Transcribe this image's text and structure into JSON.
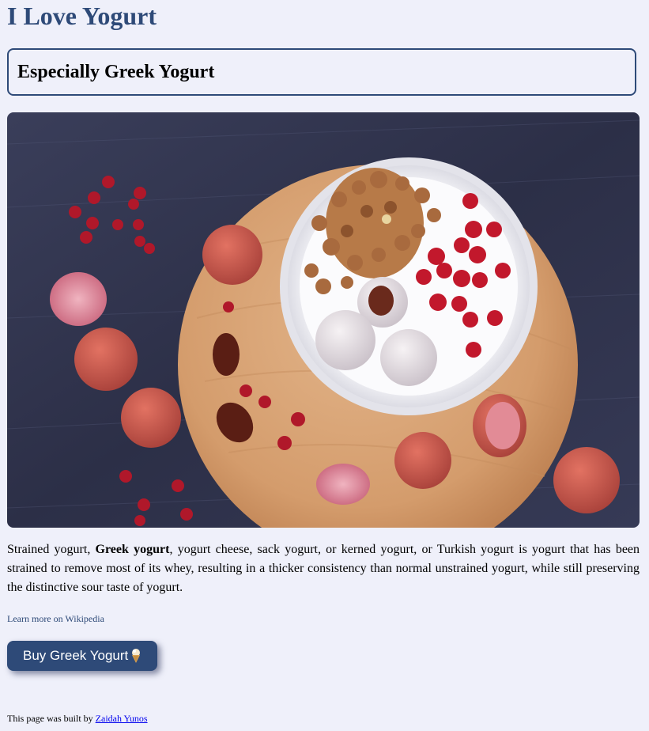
{
  "header": {
    "title": "I Love Yogurt",
    "subtitle": "Especially Greek Yogurt"
  },
  "hero_image": {
    "alt": "Greek yogurt bowl with granola, lychees and pomegranate seeds on a wooden board"
  },
  "description": {
    "before": "Strained yogurt, ",
    "bold": "Greek yogurt",
    "after": ", yogurt cheese, sack yogurt, or kerned yogurt, or Turkish yogurt is yogurt that has been strained to remove most of its whey, resulting in a thicker consistency than normal unstrained yogurt, while still preserving the distinctive sour taste of yogurt."
  },
  "links": {
    "wikipedia": "Learn more on Wikipedia"
  },
  "buy_button": {
    "label": "Buy Greek Yogurt",
    "icon": "ice-cream-cone-icon"
  },
  "footer": {
    "text": "This page was built by ",
    "author": "Zaidah Yunos"
  },
  "colors": {
    "accent": "#2e4a78",
    "background": "#eff0fa",
    "link": "#0000ee"
  }
}
